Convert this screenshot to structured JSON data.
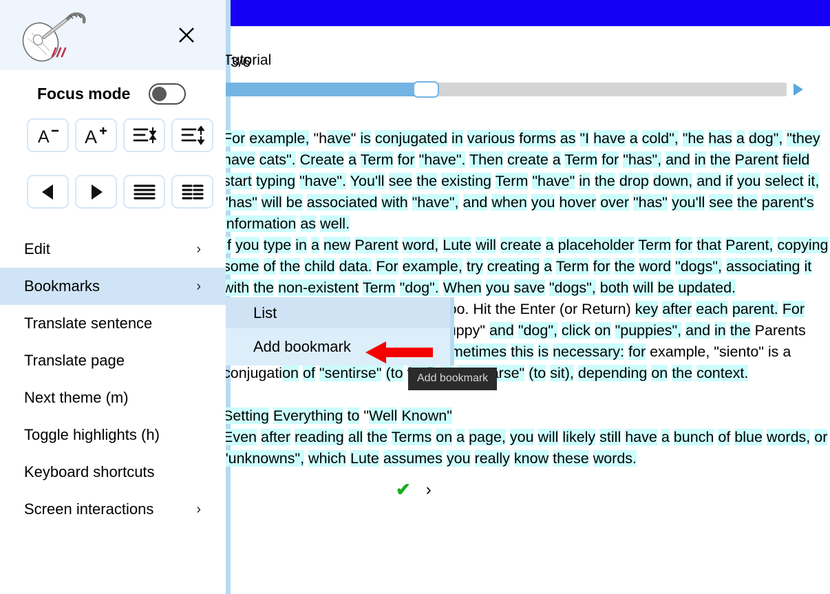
{
  "app": {
    "logo_name": "lute-logo",
    "close_label": "×"
  },
  "sidebar": {
    "focus": {
      "label": "Focus mode",
      "state": "off"
    },
    "buttons": [
      {
        "name": "decrease-font-size",
        "glyph": "A−",
        "label": "A-"
      },
      {
        "name": "increase-font-size",
        "glyph": "A+",
        "label": "A+"
      },
      {
        "name": "decrease-line-height",
        "glyph": "line-height-down",
        "label": "Decrease line height"
      },
      {
        "name": "increase-line-height",
        "glyph": "line-height-up",
        "label": "Increase line height"
      },
      {
        "name": "previous-page",
        "glyph": "◀",
        "label": "Previous"
      },
      {
        "name": "next-page",
        "glyph": "▶",
        "label": "Next"
      },
      {
        "name": "one-column",
        "glyph": "one-column",
        "label": "One column"
      },
      {
        "name": "two-columns",
        "glyph": "two-columns",
        "label": "Two columns"
      }
    ],
    "menu": [
      {
        "label": "Edit",
        "chevron": "›",
        "selected": false
      },
      {
        "label": "Bookmarks",
        "chevron": "›",
        "selected": true
      },
      {
        "label": "Translate sentence",
        "chevron": "",
        "selected": false
      },
      {
        "label": "Translate page",
        "chevron": "",
        "selected": false
      },
      {
        "label": "Next theme (m)",
        "chevron": "",
        "selected": false
      },
      {
        "label": "Toggle highlights (h)",
        "chevron": "",
        "selected": false
      },
      {
        "label": "Keyboard shortcuts",
        "chevron": "",
        "selected": false
      },
      {
        "label": "Screen interactions",
        "chevron": "›",
        "selected": false
      }
    ]
  },
  "submenu": {
    "items": [
      {
        "label": "List"
      },
      {
        "label": "Add bookmark"
      }
    ]
  },
  "tooltip": {
    "text": "Add bookmark"
  },
  "reader": {
    "title": "Tutorial",
    "page_counter": "3/6",
    "progress_percent": 36,
    "next_arrow_name": "next-page-arrow",
    "check_glyph": "✔",
    "chevron_glyph": "›",
    "paragraphs": [
      "For example, \"have\" is conjugated in various forms as \"I have a cold\", \"he has a dog\", \"they have cats\". Create a Term for \"have\". Then create a Term for \"has\", and in the Parent field start typing \"have\". You'll see the existing Term \"have\" in the drop down, and if you select it, \"has\" will be associated with \"have\", and when you hover over \"has\" you'll see the parent's information as well.",
      "If you type in a new Parent word, Lute will create a placeholder Term for that Parent, copying some of the child data. For example, try creating a Term for the word \"dogs\", associating it with the non-existent Term \"dog\". When you save \"dogs\", both will be updated.",
      "Terms can have multiple parents, too. Hit the Enter (or Return) key after each parent. For example, if you create terms for \"puppy\" and \"dog\", click on \"puppies\", and in the Parents field type \"puppy\" and hit Enter, then \"dog\" and hit Enter. Sometimes this is necessary: for example, \"siento\" is a conjugation of \"sentirse\" (to feel) or \"sentarse\" (to sit), depending on the context.",
      "Setting Everything to \"Well Known\"",
      "Even after reading all the Terms on a page, you will likely still have a bunch of blue words, or \"unknowns\", which Lute assumes you really know these words."
    ]
  },
  "colors": {
    "topbar_blue": "#1500f5",
    "highlight_cyan": "#ccfdfd",
    "selected_menu_blue": "#cfe4f7",
    "submenu_list_blue": "#cfe3f5",
    "submenu_add_blue": "#ddeefb",
    "arrow_red": "#f50000",
    "tooltip_bg": "#2b2b2b",
    "slider_fill": "#74b4e2",
    "slider_track": "#d5d5d5",
    "check_green": "#17ae1e"
  }
}
